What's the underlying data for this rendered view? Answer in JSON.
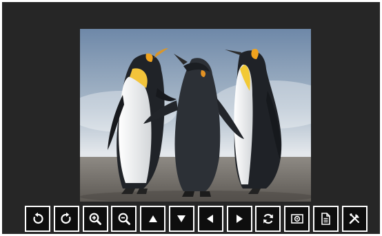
{
  "viewer": {
    "image": {
      "subject": "penguins-photo"
    },
    "toolbar": [
      {
        "id": "rotate-left",
        "icon": "rotate-ccw-icon"
      },
      {
        "id": "rotate-right",
        "icon": "rotate-cw-icon"
      },
      {
        "id": "zoom-in",
        "icon": "zoom-in-icon"
      },
      {
        "id": "zoom-out",
        "icon": "zoom-out-icon"
      },
      {
        "id": "move-up",
        "icon": "triangle-up-icon"
      },
      {
        "id": "move-down",
        "icon": "triangle-down-icon"
      },
      {
        "id": "previous",
        "icon": "triangle-left-icon"
      },
      {
        "id": "next",
        "icon": "triangle-right-icon"
      },
      {
        "id": "reset",
        "icon": "refresh-icon"
      },
      {
        "id": "actual-size",
        "icon": "actual-size-icon"
      },
      {
        "id": "info",
        "icon": "document-icon"
      },
      {
        "id": "settings",
        "icon": "tools-icon"
      }
    ]
  },
  "colors": {
    "background": "#262626",
    "button_border": "#ffffff",
    "button_fill": "#0e0e0e",
    "icon": "#ffffff"
  }
}
